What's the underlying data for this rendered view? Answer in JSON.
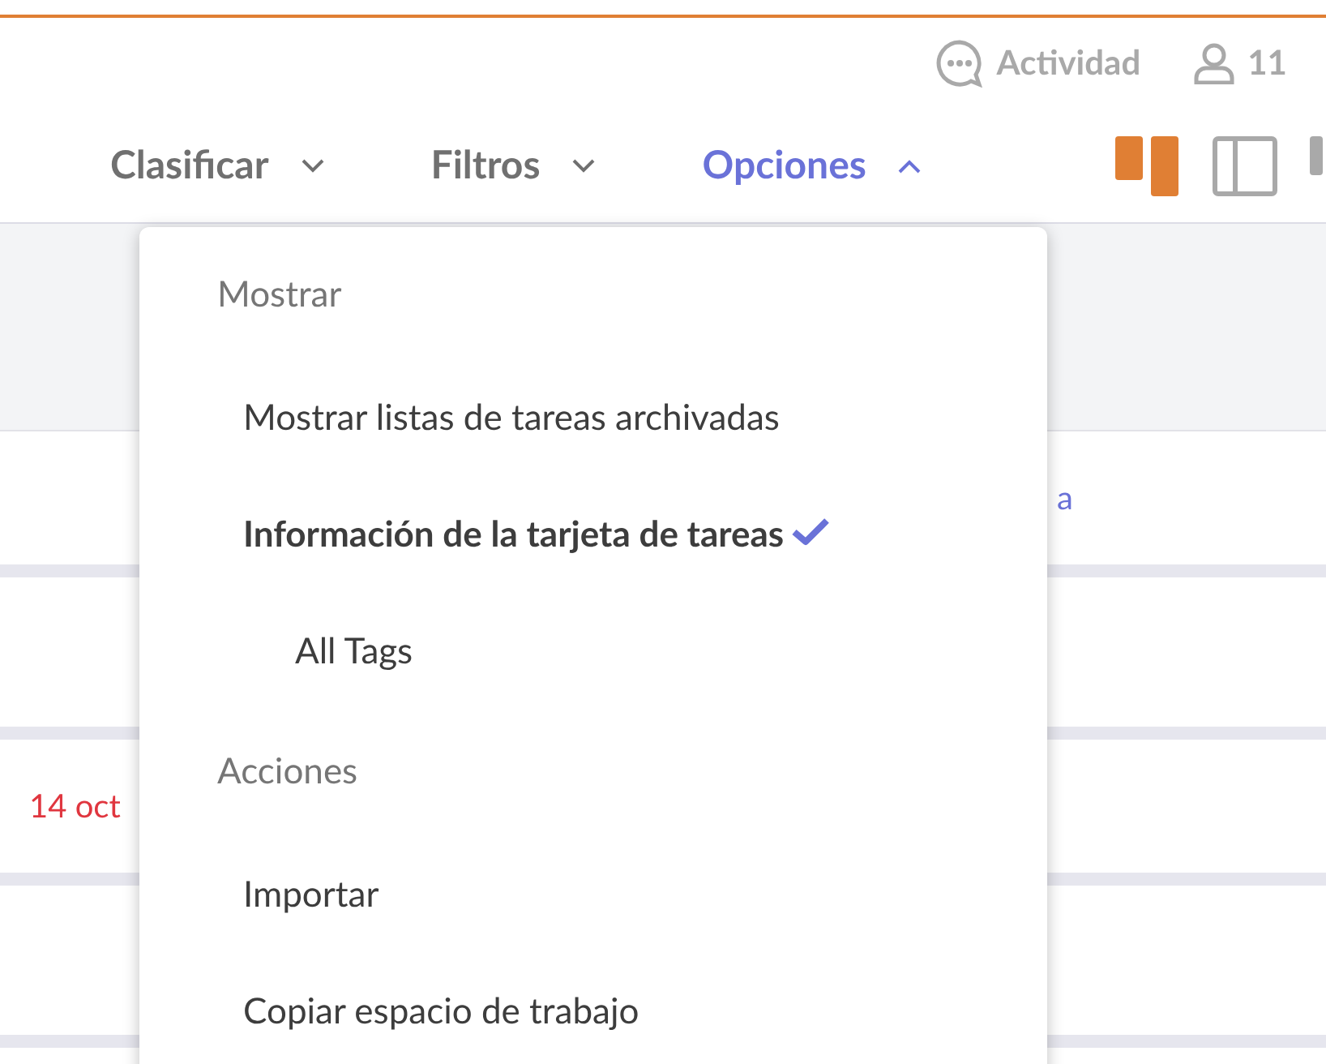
{
  "header": {
    "activity": "Actividad",
    "members": "11"
  },
  "toolbar": [
    {
      "label": "Clasificar",
      "expanded": false
    },
    {
      "label": "Filtros",
      "expanded": false
    },
    {
      "label": "Opciones",
      "expanded": true
    }
  ],
  "views": [
    {
      "kind": "board",
      "selected": true
    },
    {
      "kind": "sidebar",
      "selected": false
    },
    {
      "kind": "list",
      "selected": false
    }
  ],
  "rows": [
    {
      "text": "a",
      "kind": "link"
    },
    {
      "text": "14 oct",
      "kind": "date"
    }
  ],
  "menu": {
    "sections": [
      {
        "heading": "Mostrar",
        "items": [
          {
            "label": "Mostrar listas de tareas archivadas",
            "checked": false
          },
          {
            "label": "Información de la tarjeta de tareas",
            "checked": true,
            "children": [
              {
                "label": "All Tags",
                "checked": false
              }
            ]
          }
        ]
      },
      {
        "heading": "Acciones",
        "items": [
          {
            "label": "Importar",
            "checked": false
          },
          {
            "label": "Copiar espacio de trabajo",
            "checked": false
          }
        ]
      }
    ]
  }
}
